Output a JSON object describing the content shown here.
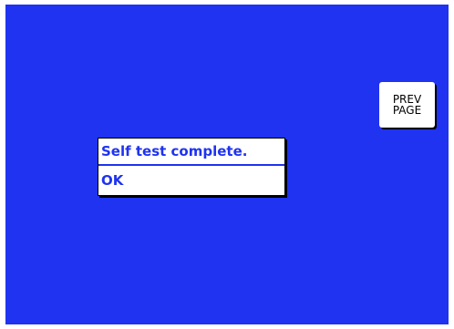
{
  "colors": {
    "screen_background": "#1f33f0",
    "dialog_text": "#1f33f0",
    "button_background": "#ffffff"
  },
  "nav": {
    "prev_page_line1": "PREV",
    "prev_page_line2": "PAGE"
  },
  "dialog": {
    "message": "Self test complete.",
    "ok_label": "OK"
  }
}
